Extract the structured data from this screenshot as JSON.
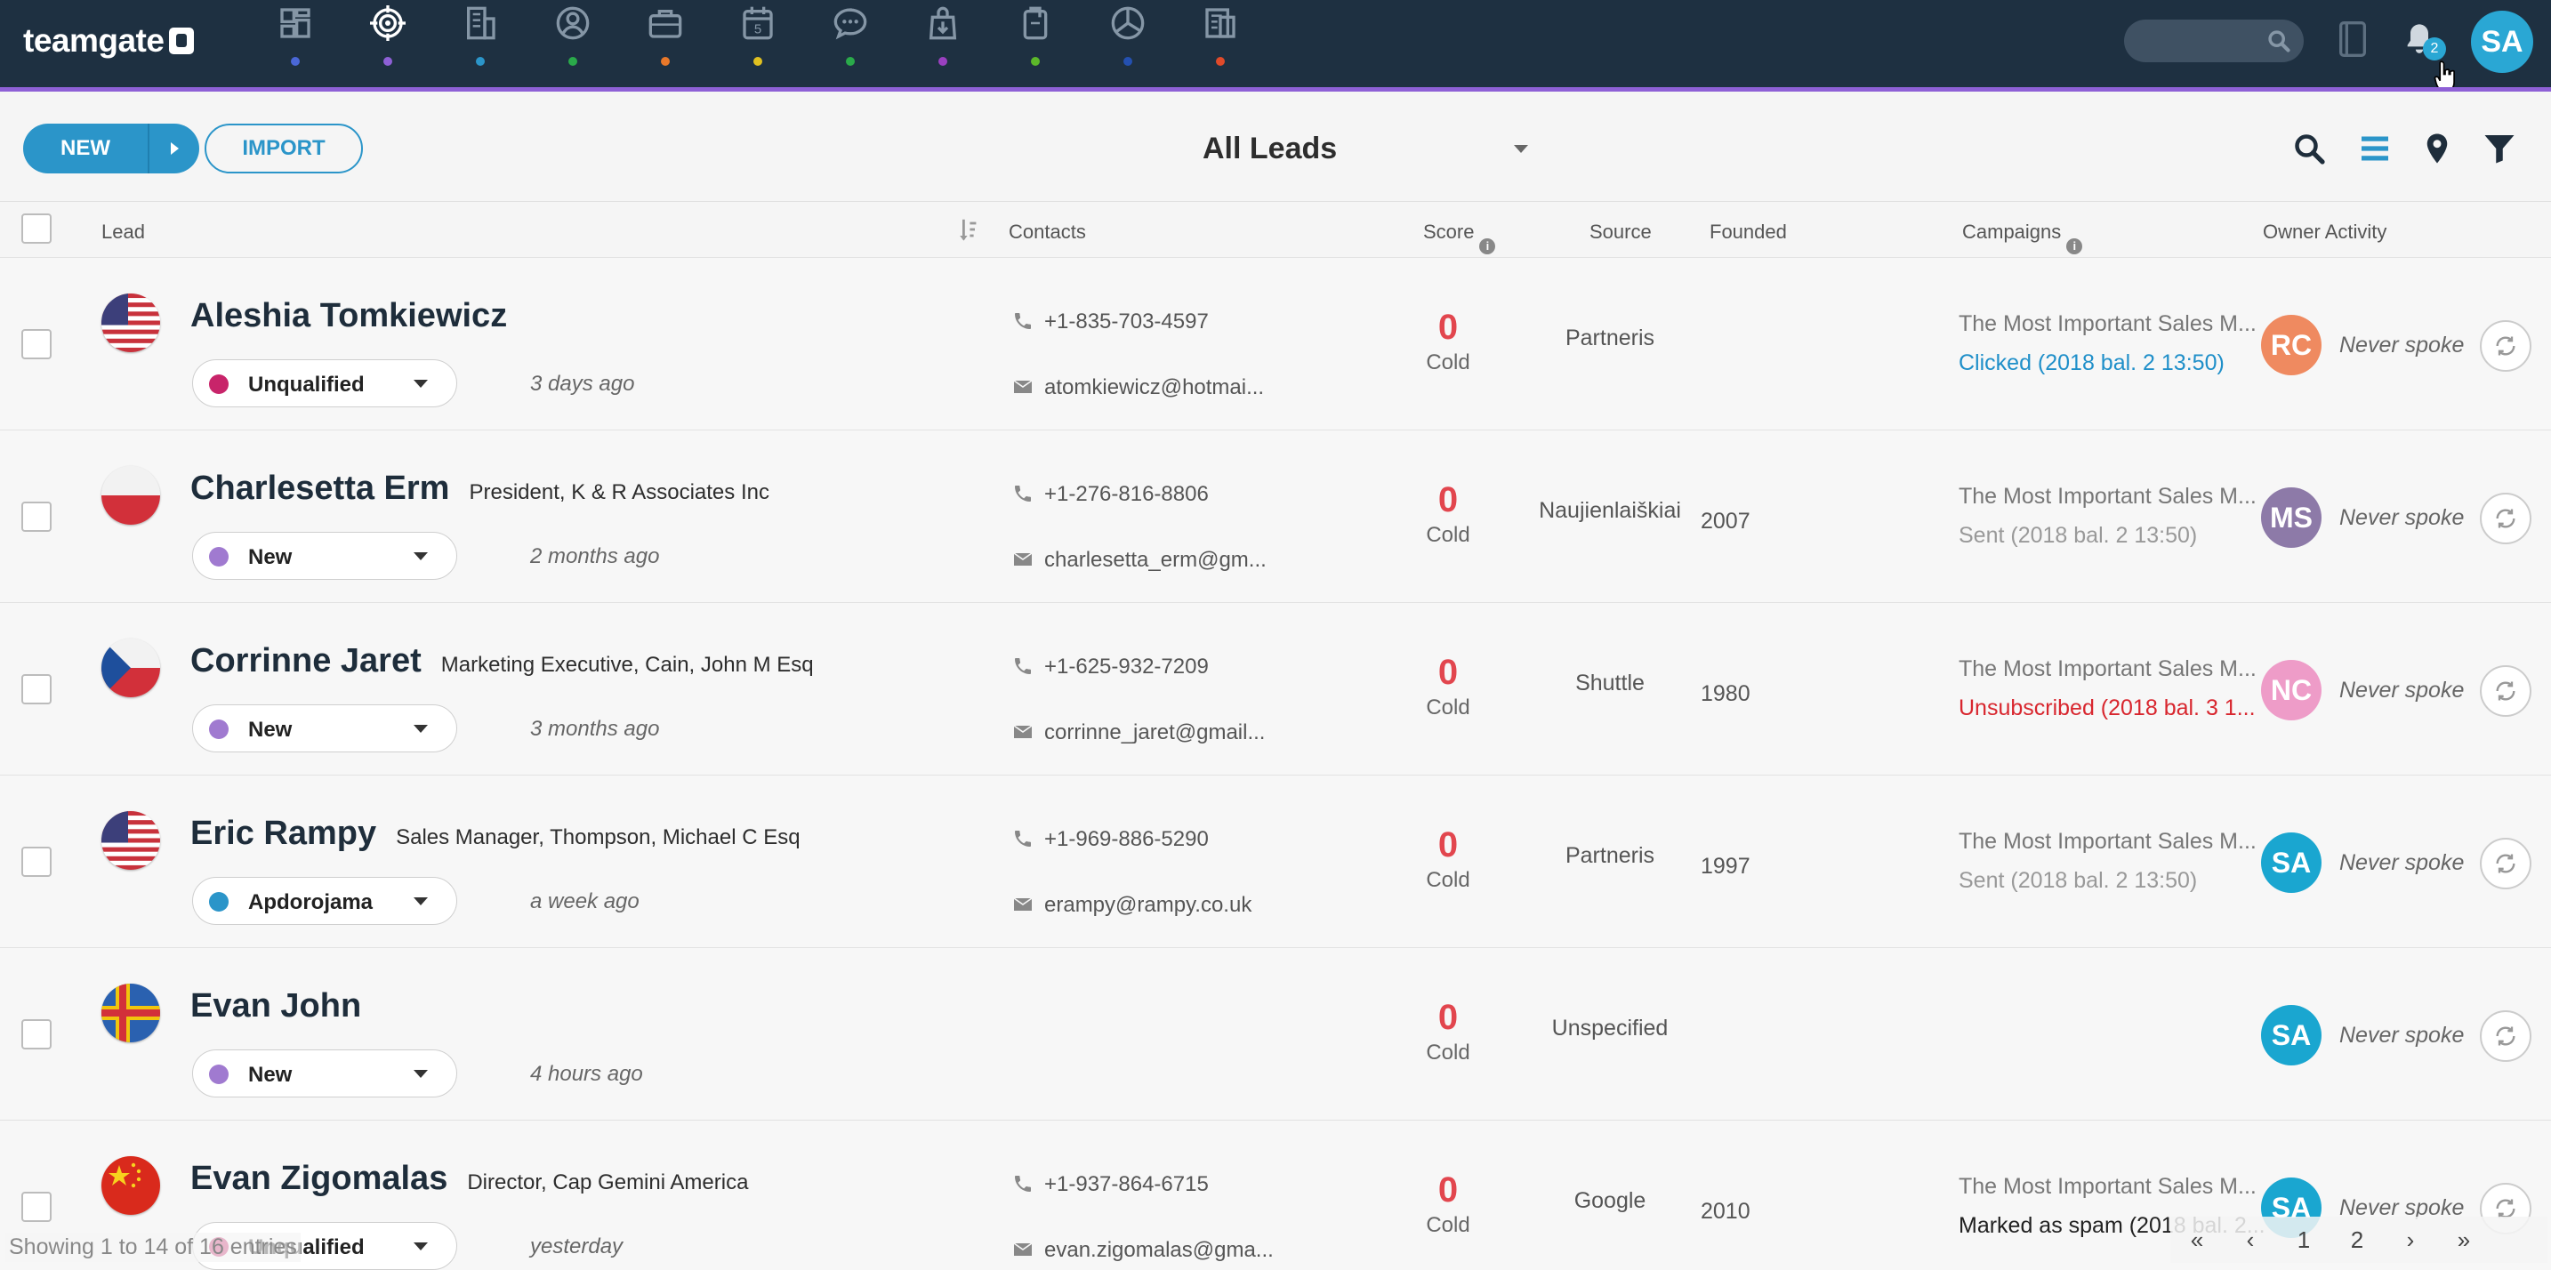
{
  "app": {
    "logo_text": "teamgate"
  },
  "nav": {
    "items": [
      {
        "icon": "dashboard-icon",
        "dot_color": "#4a67d6"
      },
      {
        "icon": "leads-target-icon",
        "dot_color": "#8e60d6",
        "active": true
      },
      {
        "icon": "companies-building-icon",
        "dot_color": "#2b95c9"
      },
      {
        "icon": "contacts-person-icon",
        "dot_color": "#2aaa4a"
      },
      {
        "icon": "deals-briefcase-icon",
        "dot_color": "#e8782a"
      },
      {
        "icon": "calendar-icon",
        "dot_color": "#e0c020"
      },
      {
        "icon": "chat-icon",
        "dot_color": "#2aaa4a"
      },
      {
        "icon": "download-icon",
        "dot_color": "#9a40c0"
      },
      {
        "icon": "documents-icon",
        "dot_color": "#5cb82a"
      },
      {
        "icon": "reports-pie-icon",
        "dot_color": "#2450b0"
      },
      {
        "icon": "invoices-icon",
        "dot_color": "#e04a2a"
      }
    ],
    "calendar_day": "5",
    "search_placeholder": "",
    "notification_count": "2",
    "user_initials": "SA"
  },
  "toolbar": {
    "new_label": "NEW",
    "import_label": "IMPORT",
    "view_title": "All Leads"
  },
  "columns": {
    "lead": "Lead",
    "contacts": "Contacts",
    "score": "Score",
    "source": "Source",
    "founded": "Founded",
    "campaigns": "Campaigns",
    "owner_activity": "Owner Activity"
  },
  "rows": [
    {
      "flag": "us",
      "name": "Aleshia Tomkiewicz",
      "title": "",
      "status": "Unqualified",
      "status_color": "#c8246a",
      "ago": "3 days ago",
      "phone": "+1-835-703-4597",
      "email": "atomkiewicz@hotmai...",
      "score": "0",
      "score_label": "Cold",
      "source": "Partneris",
      "founded": "",
      "campaign": "The Most Important Sales M...",
      "campaign_status": "Clicked (2018 bal. 2 13:50)",
      "campaign_status_color": "#1f8fc9",
      "owner_initials": "RC",
      "owner_color": "#ef8a60",
      "activity": "Never spoke"
    },
    {
      "flag": "pl",
      "name": "Charlesetta Erm",
      "title": "President, K & R Associates Inc",
      "status": "New",
      "status_color": "#a07ad0",
      "ago": "2 months ago",
      "phone": "+1-276-816-8806",
      "email": "charlesetta_erm@gm...",
      "score": "0",
      "score_label": "Cold",
      "source": "Naujienlaiškiai",
      "founded": "2007",
      "campaign": "The Most Important Sales M...",
      "campaign_status": "Sent (2018 bal. 2 13:50)",
      "campaign_status_color": "#999999",
      "owner_initials": "MS",
      "owner_color": "#8d7aa8",
      "activity": "Never spoke"
    },
    {
      "flag": "cz",
      "name": "Corrinne Jaret",
      "title": "Marketing Executive, Cain, John M Esq",
      "status": "New",
      "status_color": "#a07ad0",
      "ago": "3 months ago",
      "phone": "+1-625-932-7209",
      "email": "corrinne_jaret@gmail...",
      "score": "0",
      "score_label": "Cold",
      "source": "Shuttle",
      "founded": "1980",
      "campaign": "The Most Important Sales M...",
      "campaign_status": "Unsubscribed (2018 bal. 3 1...",
      "campaign_status_color": "#d8262e",
      "owner_initials": "NC",
      "owner_color": "#ee9cc8",
      "activity": "Never spoke"
    },
    {
      "flag": "us",
      "name": "Eric Rampy",
      "title": "Sales Manager, Thompson, Michael C Esq",
      "status": "Apdorojama",
      "status_color": "#2b95c9",
      "ago": "a week ago",
      "phone": "+1-969-886-5290",
      "email": "erampy@rampy.co.uk",
      "score": "0",
      "score_label": "Cold",
      "source": "Partneris",
      "founded": "1997",
      "campaign": "The Most Important Sales M...",
      "campaign_status": "Sent (2018 bal. 2 13:50)",
      "campaign_status_color": "#999999",
      "owner_initials": "SA",
      "owner_color": "#1aa6d0",
      "activity": "Never spoke"
    },
    {
      "flag": "ax",
      "name": "Evan John",
      "title": "",
      "status": "New",
      "status_color": "#a07ad0",
      "ago": "4 hours ago",
      "phone": "",
      "email": "",
      "score": "0",
      "score_label": "Cold",
      "source": "Unspecified",
      "founded": "",
      "campaign": "",
      "campaign_status": "",
      "campaign_status_color": "#999999",
      "owner_initials": "SA",
      "owner_color": "#1aa6d0",
      "activity": "Never spoke"
    },
    {
      "flag": "cn",
      "name": "Evan Zigomalas",
      "title": "Director, Cap Gemini America",
      "status": "Unqualified",
      "status_color": "#c8246a",
      "ago": "yesterday",
      "phone": "+1-937-864-6715",
      "email": "evan.zigomalas@gma...",
      "score": "0",
      "score_label": "Cold",
      "source": "Google",
      "founded": "2010",
      "campaign": "The Most Important Sales M...",
      "campaign_status": "Marked as spam (2018 bal. 2...",
      "campaign_status_color": "#222222",
      "owner_initials": "SA",
      "owner_color": "#1aa6d0",
      "activity": "Never spoke"
    }
  ],
  "footer": {
    "showing": "Showing 1 to 14 of 16 entries",
    "pages": [
      "«",
      "‹",
      "1",
      "2",
      "›",
      "»"
    ]
  }
}
